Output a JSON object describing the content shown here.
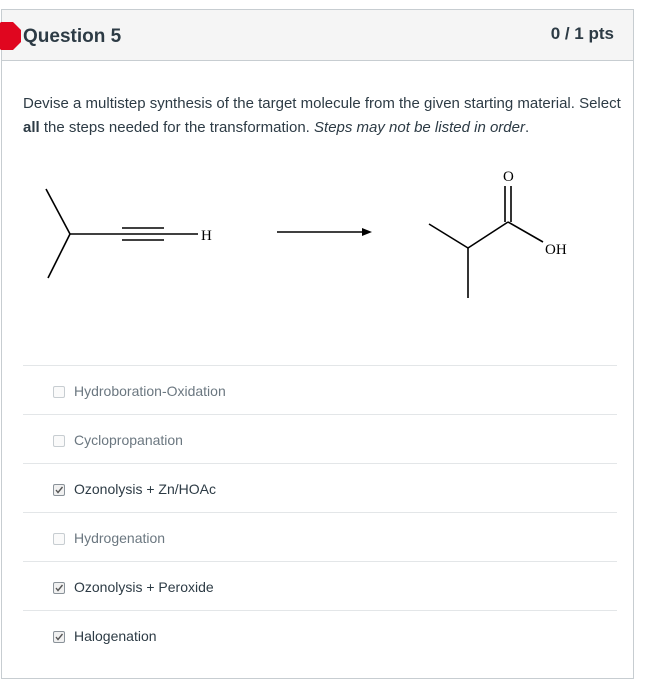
{
  "question": {
    "title": "Question 5",
    "points": "0 / 1 pts",
    "flag_color": "#e0061f",
    "prompt_part1": "Devise a multistep synthesis of the target molecule from the given starting material. Select ",
    "prompt_bold": "all",
    "prompt_part2": " the steps needed for the transformation. ",
    "prompt_italic": "Steps may not be listed in order",
    "prompt_end": "."
  },
  "scheme": {
    "start_label_h": "H",
    "product_label_o": "O",
    "product_label_oh": "OH"
  },
  "answers": [
    {
      "label": "Hydroboration-Oxidation",
      "checked": false
    },
    {
      "label": "Cyclopropanation",
      "checked": false
    },
    {
      "label": "Ozonolysis + Zn/HOAc",
      "checked": true
    },
    {
      "label": "Hydrogenation",
      "checked": false
    },
    {
      "label": "Ozonolysis + Peroxide",
      "checked": true
    },
    {
      "label": "Halogenation",
      "checked": true
    }
  ]
}
